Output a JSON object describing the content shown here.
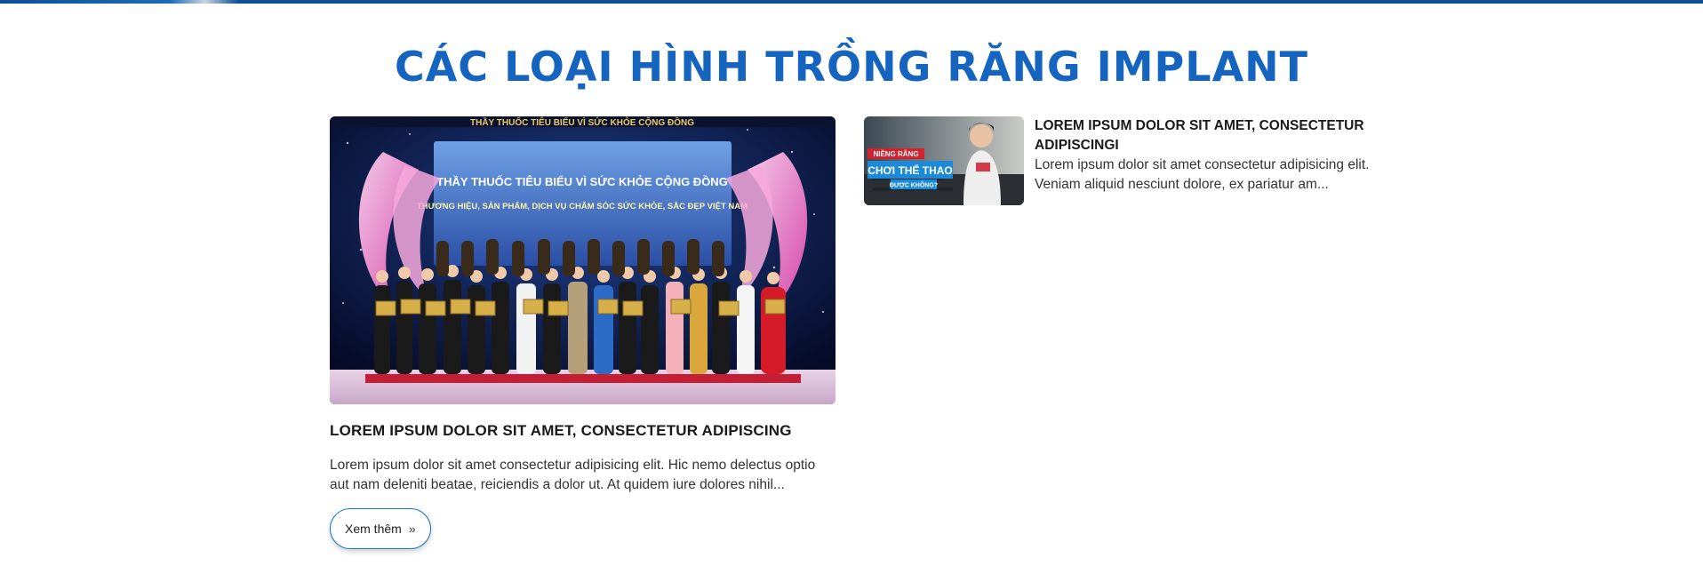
{
  "section": {
    "title": "Các loại hình trồng răng implant"
  },
  "featured": {
    "banner_line1": "THẦY THUỐC TIÊU BIỂU VÌ SỨC KHỎE CỘNG ĐỒNG",
    "banner_line2": "THƯƠNG HIỆU, SẢN PHẨM, DỊCH VỤ CHĂM SÓC SỨC KHỎE, SẮC ĐẸP VIỆT NAM",
    "top_banner": "THẦY THUỐC TIÊU BIỂU VÌ SỨC KHỎE CỘNG ĐỒNG",
    "title": "LOREM IPSUM DOLOR SIT AMET, CONSECTETUR ADIPISCING",
    "excerpt": "Lorem ipsum dolor sit amet consectetur adipisicing elit. Hic nemo delectus optio aut nam deleniti beatae, reiciendis a dolor ut. At quidem iure dolores nihil...",
    "button_label": "Xem thêm",
    "button_icon": "»"
  },
  "side_item": {
    "thumb_tag1": "NIỀNG RĂNG",
    "thumb_tag2": "CHƠI THỂ THAO",
    "thumb_tag3": "ĐƯỢC KHÔNG?",
    "title": "LOREM IPSUM DOLOR SIT AMET, CONSECTETUR ADIPISCINGI",
    "excerpt": "Lorem ipsum dolor sit amet consectetur adipisicing elit. Veniam aliquid nesciunt dolore, ex pariatur am..."
  },
  "colors": {
    "accent": "#1565c0",
    "top_bar": "#0b4f95",
    "button_border": "#1976d2"
  }
}
